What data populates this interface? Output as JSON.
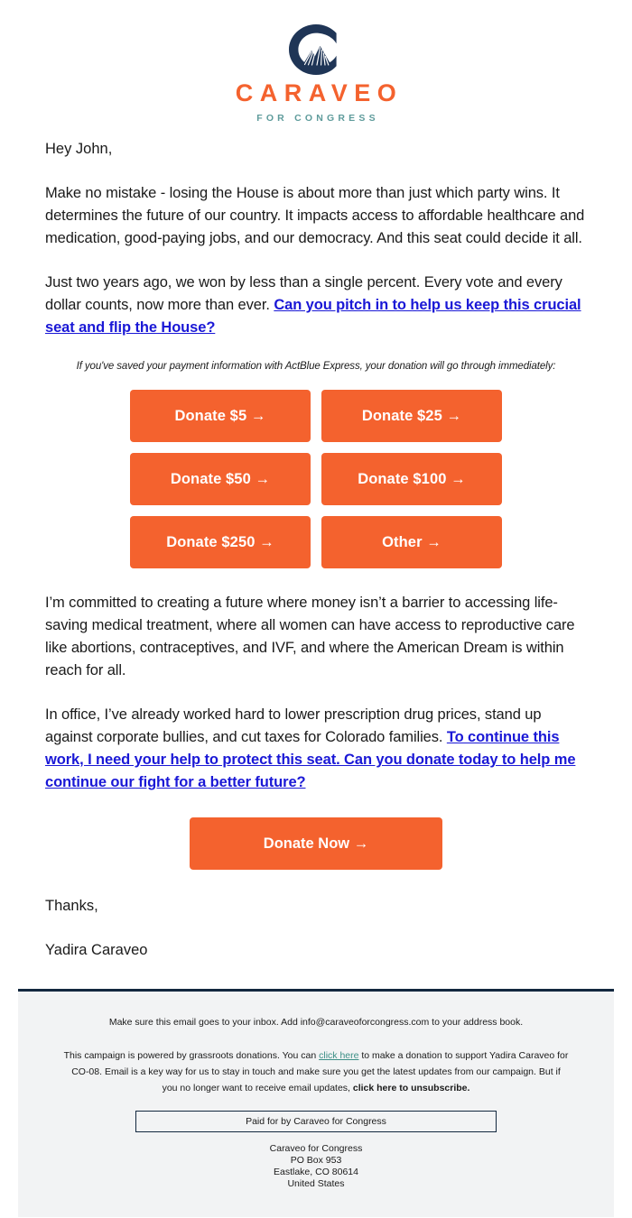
{
  "header": {
    "logo_icon": "colorado-c-mountain-logo",
    "wordmark": "CARAVEO",
    "tagline": "FOR CONGRESS",
    "brand_orange": "#F4622E",
    "brand_navy": "#1F3556",
    "brand_teal": "#5E9B9B"
  },
  "body": {
    "greeting": "Hey John,",
    "paragraph_1": "Make no mistake - losing the House is about more than just which party wins. It determines the future of our country. It impacts access to affordable healthcare and medication, good-paying jobs, and our democracy. And this seat could decide it all.",
    "paragraph_2_text": "Just two years ago, we won by less than a single percent. Every vote and every dollar counts, now more than ever. ",
    "paragraph_2_link": "Can you pitch in to help us keep this crucial seat and flip the House?",
    "actblue_note": "If you've saved your payment information with ActBlue Express, your donation will go through immediately:",
    "paragraph_3": "I’m committed to creating a future where money isn’t a barrier to accessing life-saving medical treatment, where all women can have access to reproductive care like abortions, contraceptives, and IVF, and where the American Dream is within reach for all.",
    "paragraph_4_text": "In office, I’ve already worked hard to lower prescription drug prices, stand up against corporate bullies, and cut taxes for Colorado families. ",
    "paragraph_4_link": "To continue this work, I need your help to protect this seat. Can you donate today to help me continue our fight for a better future?",
    "sign_off": "Thanks,",
    "signature_name": "Yadira Caraveo",
    "link_color": "#1a18d6"
  },
  "donations": {
    "buttons": [
      {
        "label": "Donate $5 →",
        "amount": "5"
      },
      {
        "label": "Donate $25 →",
        "amount": "25"
      },
      {
        "label": "Donate $50 →",
        "amount": "50"
      },
      {
        "label": "Donate $100 →",
        "amount": "100"
      },
      {
        "label": "Donate $250 →",
        "amount": "250"
      },
      {
        "label": "Other →",
        "amount": "other"
      }
    ],
    "cta_label": "Donate Now →"
  },
  "footer": {
    "inbox_notice": "Make sure this email goes to your inbox. Add info@caraveoforcongress.com to your address book.",
    "disclaimer_part_1": "This campaign is powered by grassroots donations. You can ",
    "disclaimer_link_1": "click here",
    "disclaimer_part_2": " to make a donation to support Yadira Caraveo for CO-08. Email is a key way for us to stay in touch and make sure you get the latest updates from our campaign. But if you no longer want to receive email updates, ",
    "disclaimer_link_2": "click here to unsubscribe.",
    "paid_for": "Paid for by Caraveo for Congress",
    "address_line_1": "Caraveo for Congress",
    "address_line_2": "PO Box 953",
    "address_line_3": "Eastlake, CO 80614",
    "address_line_4": "United States",
    "link_teal": "#3c8f86",
    "background": "#f2f3f4",
    "divider_color": "#13283f"
  }
}
